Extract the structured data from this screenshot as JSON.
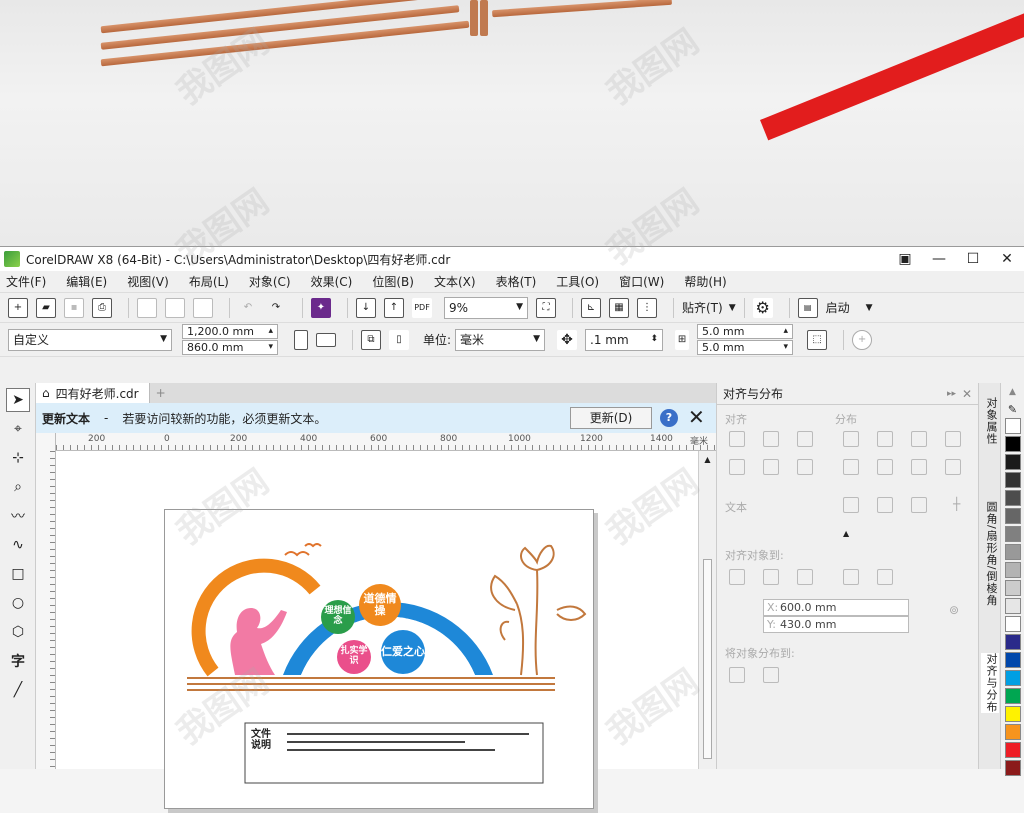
{
  "window": {
    "title": "CorelDRAW X8 (64-Bit) - C:\\Users\\Administrator\\Desktop\\四有好老师.cdr"
  },
  "menu": [
    "文件(F)",
    "编辑(E)",
    "视图(V)",
    "布局(L)",
    "对象(C)",
    "效果(C)",
    "位图(B)",
    "文本(X)",
    "表格(T)",
    "工具(O)",
    "窗口(W)",
    "帮助(H)"
  ],
  "toolbar": {
    "zoom": "9%",
    "snap_label": "贴齐(T)",
    "launch_label": "启动"
  },
  "propbar": {
    "preset": "自定义",
    "width": "1,200.0 mm",
    "height": "860.0 mm",
    "units_label": "单位:",
    "units_value": "毫米",
    "nudge": ".1 mm",
    "dup_x": "5.0 mm",
    "dup_y": "5.0 mm"
  },
  "document": {
    "tab_name": "四有好老师.cdr",
    "notice_title": "更新文本",
    "notice_dash": "-",
    "notice_text": "若要访问较新的功能，必须更新文本。",
    "update_button": "更新(D)"
  },
  "ruler": {
    "labels": [
      "200",
      "0",
      "200",
      "400",
      "600",
      "800",
      "1000",
      "1200",
      "1400"
    ],
    "unit": "毫米"
  },
  "artwork": {
    "bubbles": [
      "理想信念",
      "道德情操",
      "扎实学识",
      "仁爱之心"
    ],
    "caption": "文件说明"
  },
  "dock": {
    "title": "对齐与分布",
    "align_label": "对齐",
    "distribute_label": "分布",
    "text_label": "文本",
    "align_to_label": "对齐对象到:",
    "x_value": "600.0 mm",
    "y_value": "430.0 mm",
    "distribute_to_label": "将对象分布到:"
  },
  "side_tabs": [
    "对象属性",
    "圆角/扇形角/倒棱角",
    "对齐与分布"
  ],
  "palette": [
    "#ffffff",
    "#000000",
    "#1a1a1a",
    "#333333",
    "#4d4d4d",
    "#666666",
    "#808080",
    "#999999",
    "#b3b3b3",
    "#cccccc",
    "#e6e6e6",
    "#ffffff",
    "#2a2a8a",
    "#0047ab",
    "#009fe3",
    "#00a651",
    "#fff200",
    "#f7941d",
    "#ed1c24",
    "#8b1a1a"
  ],
  "watermark": "我图网"
}
